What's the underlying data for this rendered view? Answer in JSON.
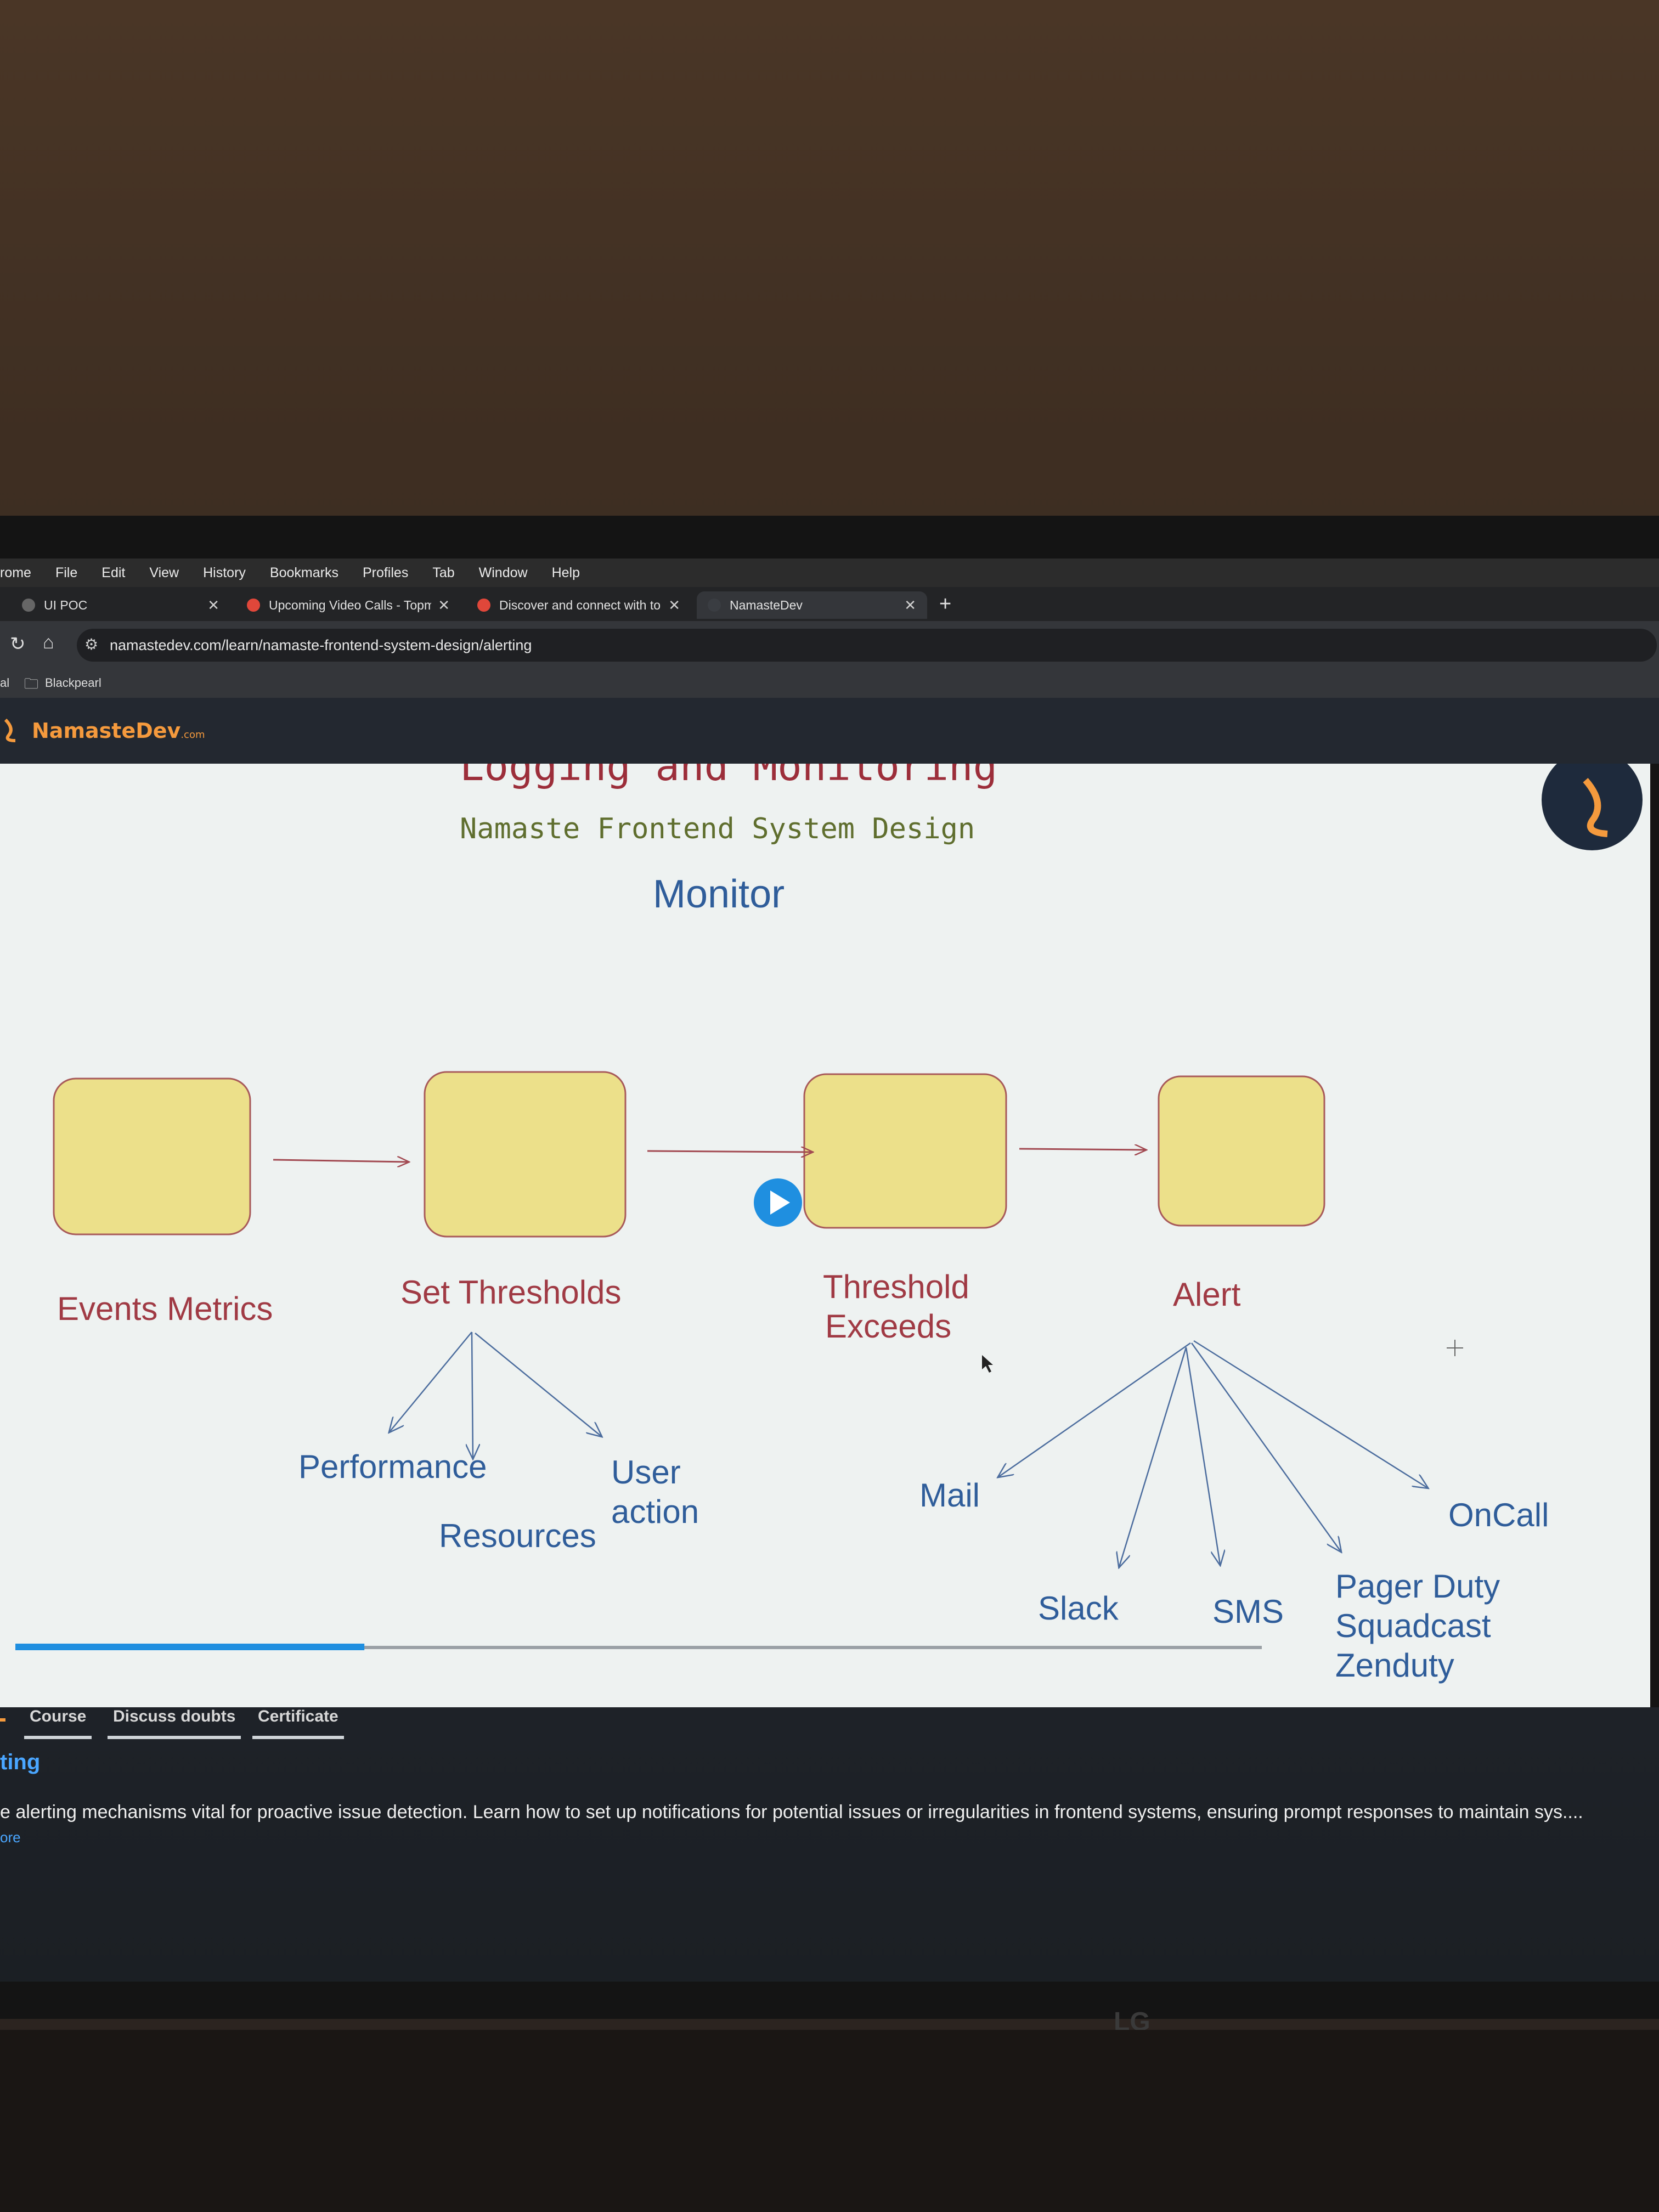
{
  "menubar": {
    "items": [
      "rome",
      "File",
      "Edit",
      "View",
      "History",
      "Bookmarks",
      "Profiles",
      "Tab",
      "Window",
      "Help"
    ]
  },
  "tabs": [
    {
      "title": "UI POC"
    },
    {
      "title": "Upcoming Video Calls - Topm"
    },
    {
      "title": "Discover and connect with to"
    },
    {
      "title": "NamasteDev"
    }
  ],
  "address": {
    "url": "namastedev.com/learn/namaste-frontend-system-design/alerting"
  },
  "bookmarks": {
    "prefix": "al",
    "folder": "Blackpearl"
  },
  "site": {
    "logo_main": "NamasteDev",
    "logo_suffix": ".com"
  },
  "slide": {
    "title": "Logging and Monitoring",
    "subtitle": "Namaste Frontend System Design",
    "heading": "Monitor",
    "stages": [
      "Events Metrics",
      "Set Thresholds",
      "Threshold",
      "Exceeds",
      "Alert"
    ],
    "threshold_branches": [
      "Performance",
      "Resources",
      "User",
      "action"
    ],
    "alert_channels": [
      "Mail",
      "Slack",
      "SMS",
      "Pager Duty",
      "Squadcast",
      "Zenduty",
      "OnCall"
    ],
    "progress": 0.28
  },
  "course_tabs": [
    "Course",
    "Discuss doubts",
    "Certificate"
  ],
  "lesson": {
    "title": "ting",
    "description": "e alerting mechanisms vital for proactive issue detection. Learn how to set up notifications for potential issues or irregularities in frontend systems, ensuring prompt responses to maintain sys....",
    "read_more": "ore"
  },
  "monitor_brand": "LG",
  "colors": {
    "accent": "#f59a3d",
    "link": "#4aa6ff",
    "box_fill": "#ece08a",
    "stage_text": "#a03a44",
    "branch_text": "#2f5d9a"
  }
}
